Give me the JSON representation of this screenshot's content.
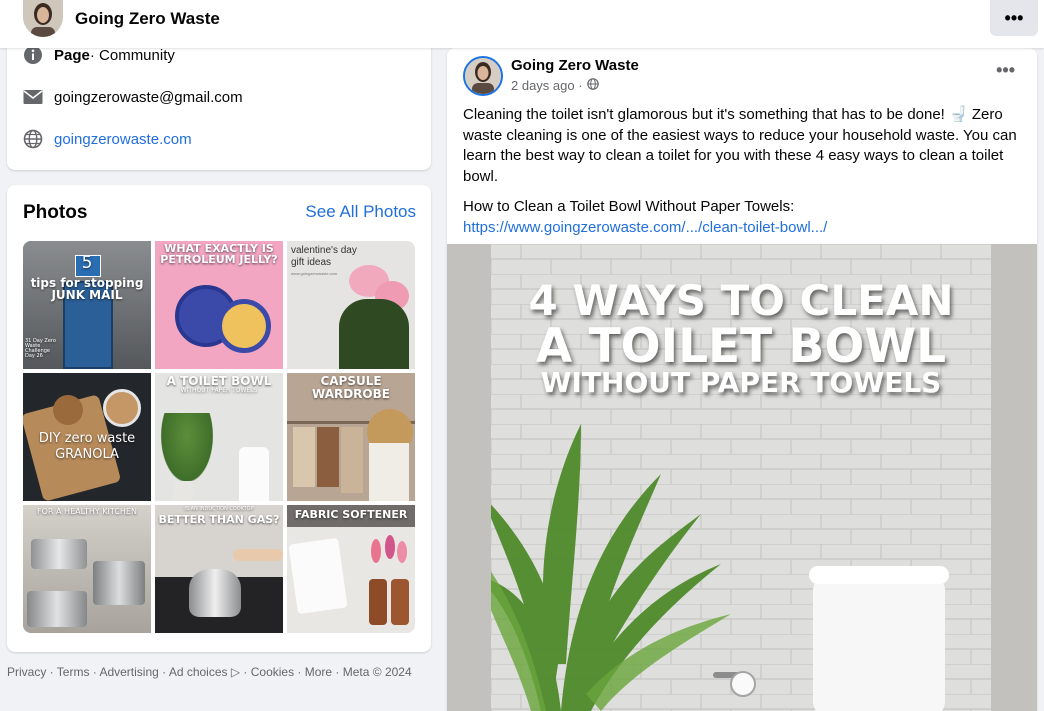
{
  "header": {
    "page_name": "Going Zero Waste",
    "more_icon": "more-horizontal-icon"
  },
  "intro": {
    "page_type_bold": "Page",
    "page_type_rest": " · Community",
    "email": "goingzerowaste@gmail.com",
    "website": "goingzerowaste.com"
  },
  "photos": {
    "title": "Photos",
    "see_all": "See All Photos",
    "tiles": [
      {
        "caption_top": "5",
        "caption": "tips for stopping JUNK MAIL",
        "small": "31 Day Zero Waste Challenge Day 26"
      },
      {
        "caption": "WHAT EXACTLY IS PETROLEUM JELLY?"
      },
      {
        "caption": "valentine's day gift ideas",
        "small": "www.goingzerowaste.com"
      },
      {
        "caption": "DIY zero waste GRANOLA"
      },
      {
        "caption": "A TOILET BOWL",
        "small": "WITHOUT PAPER TOWELS"
      },
      {
        "caption": "CAPSULE WARDROBE"
      },
      {
        "caption": "FOR A HEALTHY KITCHEN"
      },
      {
        "caption": "IS AN INDUCTION COOKTOP",
        "small2": "BETTER THAN GAS?"
      },
      {
        "caption": "FABRIC SOFTENER"
      }
    ]
  },
  "footer": {
    "text": "Privacy · Terms · Advertising · Ad choices ▷ · Cookies · More · Meta © 2024"
  },
  "post": {
    "author": "Going Zero Waste",
    "time": "2 days ago ·",
    "paragraph1": "Cleaning the toilet isn't glamorous but it's something that has to be done! 🚽 Zero waste cleaning is one of the easiest ways to reduce your household waste. You can learn the best way to clean a toilet for you with these 4 easy ways to clean a toilet bowl.",
    "paragraph2": "How to Clean a Toilet Bowl Without Paper Towels:",
    "link": "https://www.goingzerowaste.com/.../clean-toilet-bowl.../",
    "image_line1": "4 WAYS TO CLEAN",
    "image_line2": "A TOILET BOWL",
    "image_line3": "WITHOUT PAPER TOWELS"
  },
  "colors": {
    "link": "#216fdb",
    "background": "#f0f2f5",
    "card": "#ffffff",
    "muted": "#65676b"
  }
}
